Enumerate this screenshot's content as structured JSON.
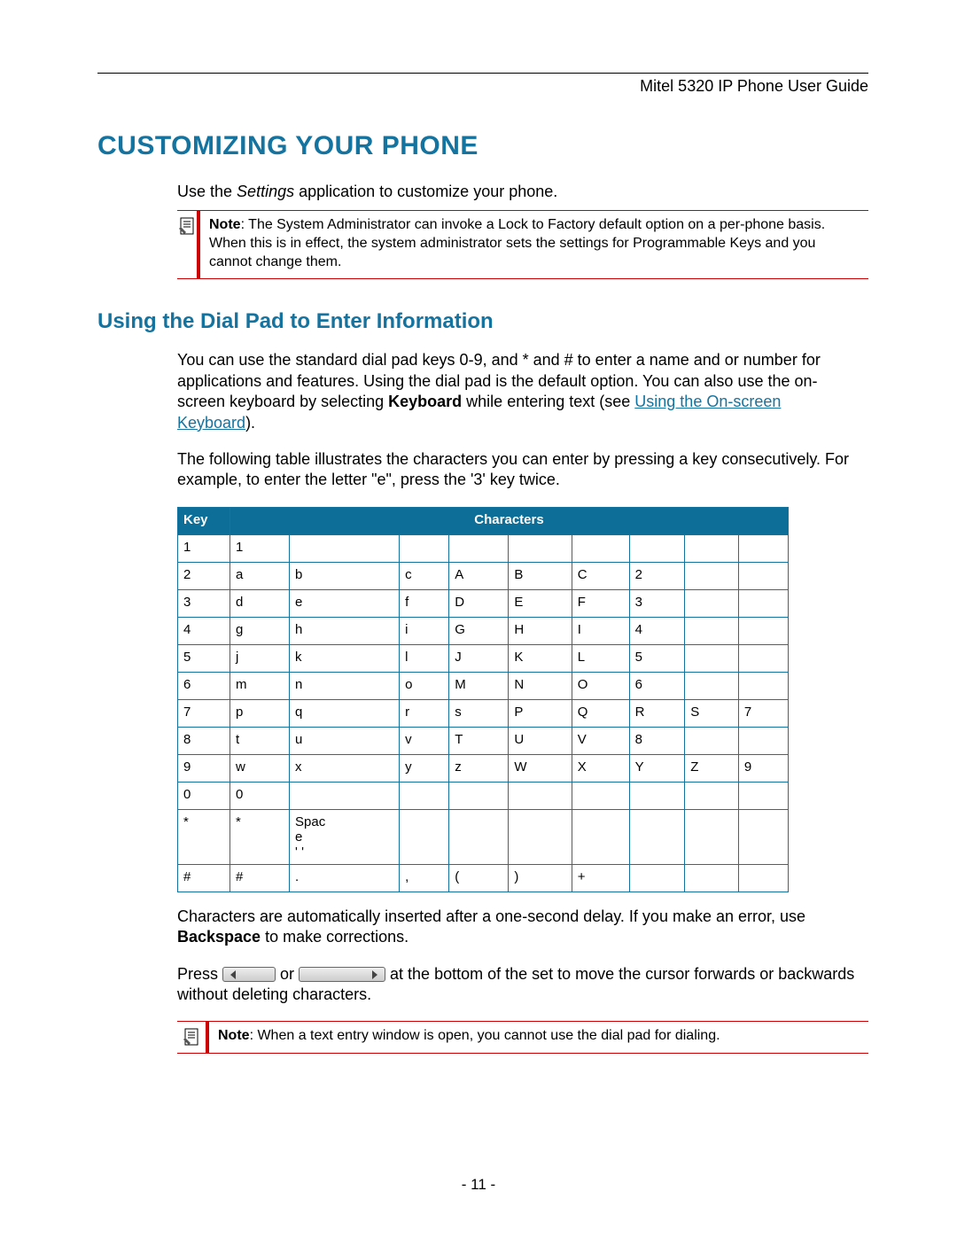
{
  "header": {
    "doc_title": "Mitel 5320 IP Phone User Guide"
  },
  "h1": "CUSTOMIZING YOUR PHONE",
  "intro": {
    "pre": "Use the ",
    "italic": "Settings",
    "post": " application to customize your phone."
  },
  "note1": {
    "label": "Note",
    "text": ": The System Administrator can invoke a Lock to Factory default option on a per-phone basis. When this is in effect, the system administrator sets the settings for Programmable Keys and you cannot change them."
  },
  "h2": "Using the Dial Pad to Enter Information",
  "p1": {
    "a": "You can use the standard dial pad keys 0-9, and * and # to enter a name and or number for applications and features. Using the dial pad is the default option. You can also use the on-screen keyboard by selecting ",
    "bold": "Keyboard",
    "b": " while entering text (see ",
    "link": "Using the On-screen Keyboard",
    "c": ")."
  },
  "p2": "The following table illustrates the characters you can enter by pressing a key consecutively. For example, to enter the letter \"e\", press the '3' key twice.",
  "table": {
    "headers": {
      "key": "Key",
      "chars": "Characters"
    },
    "rows": [
      {
        "key": "1",
        "cells": [
          "1",
          "",
          "",
          "",
          "",
          "",
          "",
          "",
          ""
        ]
      },
      {
        "key": "2",
        "cells": [
          "a",
          "b",
          "c",
          "A",
          "B",
          "C",
          "2",
          "",
          ""
        ]
      },
      {
        "key": "3",
        "cells": [
          "d",
          "e",
          "f",
          "D",
          "E",
          "F",
          "3",
          "",
          ""
        ]
      },
      {
        "key": "4",
        "cells": [
          "g",
          "h",
          "i",
          "G",
          "H",
          "I",
          "4",
          "",
          ""
        ]
      },
      {
        "key": "5",
        "cells": [
          "j",
          "k",
          "l",
          "J",
          "K",
          "L",
          "5",
          "",
          ""
        ]
      },
      {
        "key": "6",
        "cells": [
          "m",
          "n",
          "o",
          "M",
          "N",
          "O",
          "6",
          "",
          ""
        ]
      },
      {
        "key": "7",
        "cells": [
          "p",
          "q",
          "r",
          "s",
          "P",
          "Q",
          "R",
          "S",
          "7"
        ]
      },
      {
        "key": "8",
        "cells": [
          "t",
          "u",
          "v",
          "T",
          "U",
          "V",
          "8",
          "",
          ""
        ]
      },
      {
        "key": "9",
        "cells": [
          "w",
          "x",
          "y",
          "z",
          "W",
          "X",
          "Y",
          "Z",
          "9"
        ]
      },
      {
        "key": "0",
        "cells": [
          "0",
          "",
          "",
          "",
          "",
          "",
          "",
          "",
          ""
        ]
      },
      {
        "key": "*",
        "cells": [
          "*",
          "Spac\ne\n' '",
          "",
          "",
          "",
          "",
          "",
          "",
          ""
        ]
      },
      {
        "key": "#",
        "cells": [
          "#",
          ".",
          ",",
          "(",
          ")",
          "+",
          "",
          "",
          ""
        ]
      }
    ]
  },
  "p3": {
    "a": "Characters are automatically inserted after a one-second delay. If you make an error, use ",
    "bold": "Backspace",
    "b": " to make corrections."
  },
  "p4": {
    "a": "Press ",
    "b": " or ",
    "c": " at the bottom of the set to move the cursor forwards or backwards without deleting characters."
  },
  "note2": {
    "label": "Note",
    "text": ": When a text entry window is open, you cannot use the dial pad for dialing."
  },
  "footer": {
    "page": "- 11 -"
  }
}
